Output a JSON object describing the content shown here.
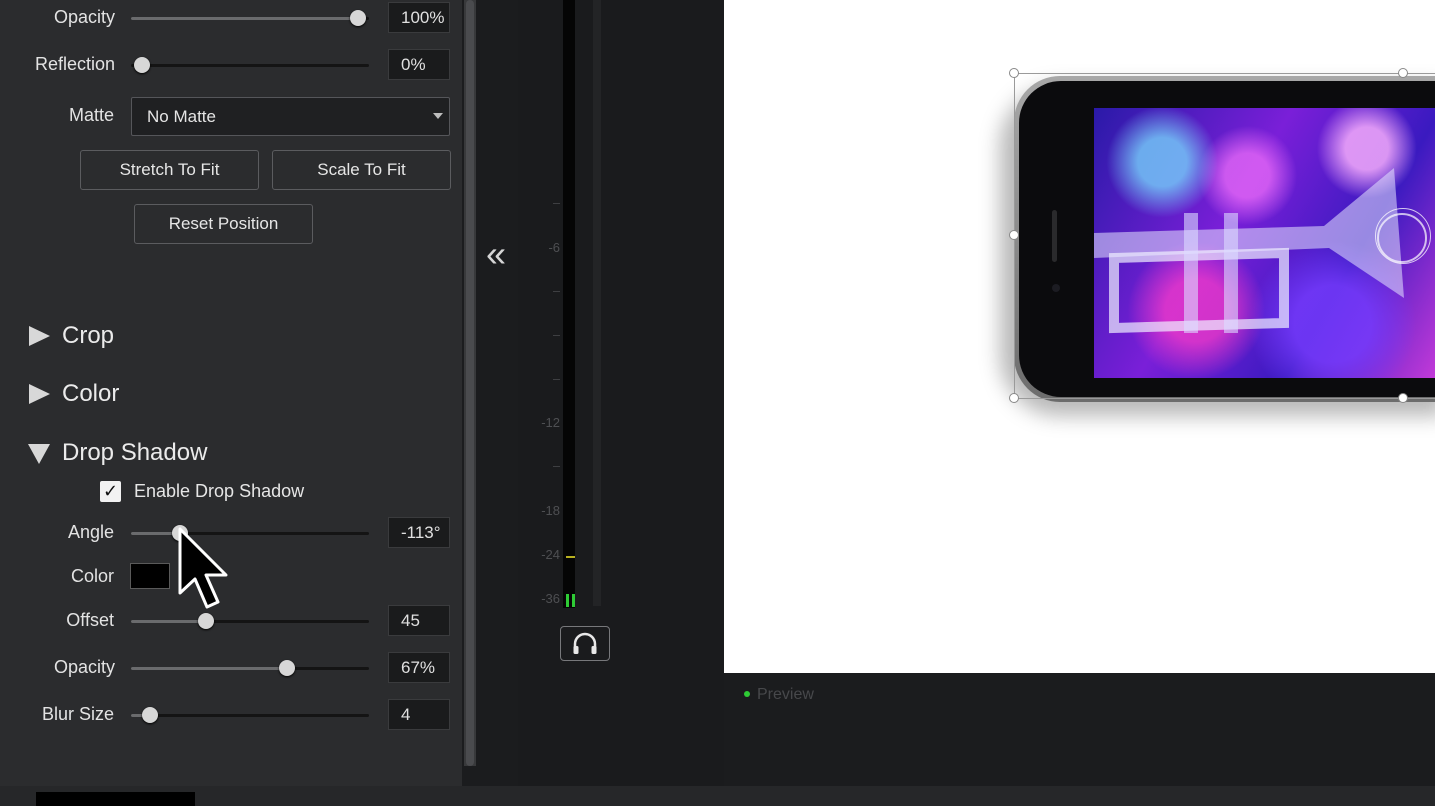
{
  "transform": {
    "opacity": {
      "label": "Opacity",
      "value": "100%",
      "level": 1.0
    },
    "reflection": {
      "label": "Reflection",
      "value": "0%",
      "level": 0.0
    },
    "matte": {
      "label": "Matte",
      "selected": "No Matte"
    },
    "buttons": {
      "stretch": "Stretch To Fit",
      "scale": "Scale To Fit",
      "reset": "Reset Position"
    }
  },
  "sections": {
    "crop": "Crop",
    "color": "Color",
    "drop_shadow": "Drop Shadow"
  },
  "drop_shadow": {
    "enable_label": "Enable Drop Shadow",
    "enabled": true,
    "check_glyph": "✓",
    "angle": {
      "label": "Angle",
      "value": "-113°"
    },
    "color": {
      "label": "Color",
      "swatch": "#000000"
    },
    "offset": {
      "label": "Offset",
      "value": "45"
    },
    "opacity": {
      "label": "Opacity",
      "value": "67%"
    },
    "blur": {
      "label": "Blur Size",
      "value": "4"
    }
  },
  "meter": {
    "labels": [
      "-6",
      "-12",
      "-18",
      "-24",
      "-36"
    ],
    "level_color": "#2ecb35"
  },
  "panel_toggle": "«",
  "preview": {
    "label": "Preview",
    "status_color": "#2ecb35"
  },
  "icons": {
    "headphones": "headphones-icon",
    "cursor": "arrow-cursor-icon",
    "collapse": "double-chevron-left-icon"
  }
}
